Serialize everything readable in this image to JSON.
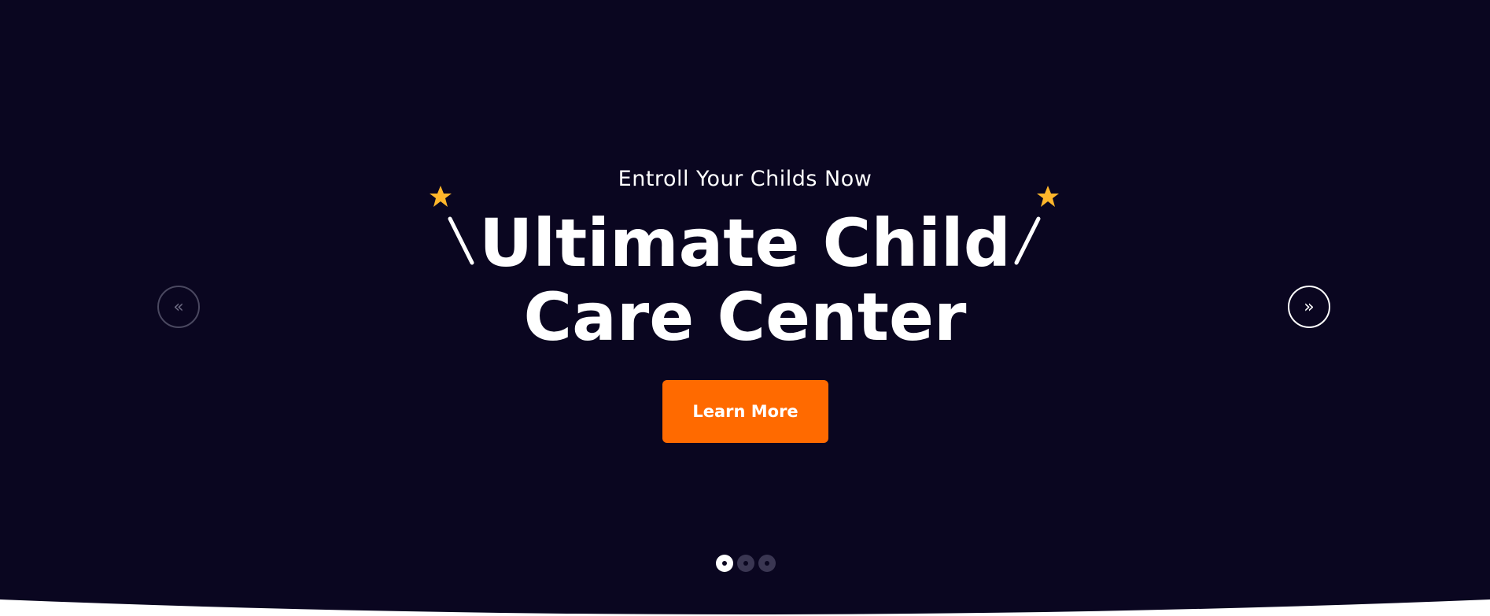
{
  "hero": {
    "subtitle": "Entroll Your Childs Now",
    "title_line1": "Ultimate Child",
    "title_line2": "Care Center",
    "cta_label": "Learn More",
    "prev_icon": "«",
    "next_icon": "»",
    "slides_total": 3,
    "active_slide": 1
  },
  "colors": {
    "background": "#0a0620",
    "accent": "#ff6a00",
    "star": "#ffb62b",
    "text": "#ffffff"
  },
  "icons": {
    "star": "star-icon",
    "prev": "double-chevron-left-icon",
    "next": "double-chevron-right-icon"
  }
}
